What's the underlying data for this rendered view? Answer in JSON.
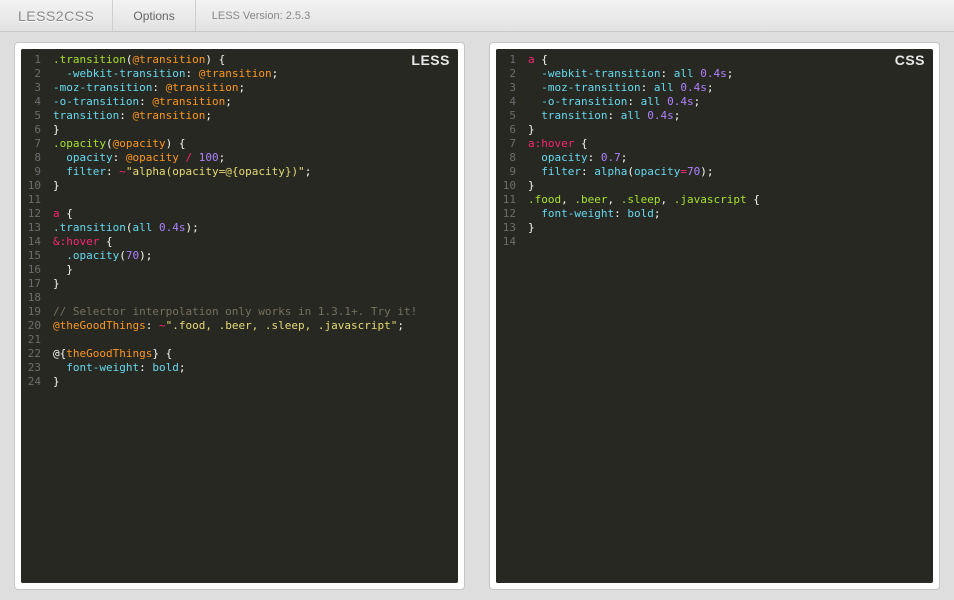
{
  "header": {
    "brand": "LESS2CSS",
    "options_label": "Options",
    "version_label": "LESS Version: 2.5.3"
  },
  "panels": {
    "left": {
      "label": "LESS"
    },
    "right": {
      "label": "CSS"
    }
  },
  "less_raw": ".transition(@transition) {\n  -webkit-transition: @transition;\n-moz-transition: @transition;\n-o-transition: @transition;\ntransition: @transition;\n}\n.opacity(@opacity) {\n  opacity: @opacity / 100;\n  filter: ~\"alpha(opacity=@{opacity})\";\n}\n\na {\n.transition(all 0.4s);\n&:hover {\n  .opacity(70);\n  }\n}\n\n// Selector interpolation only works in 1.3.1+. Try it!\n@theGoodThings: ~\".food, .beer, .sleep, .javascript\";\n\n@{theGoodThings} {\n  font-weight: bold;\n}",
  "css_raw": "a {\n  -webkit-transition: all 0.4s;\n  -moz-transition: all 0.4s;\n  -o-transition: all 0.4s;\n  transition: all 0.4s;\n}\na:hover {\n  opacity: 0.7;\n  filter: alpha(opacity=70);\n}\n.food, .beer, .sleep, .javascript {\n  font-weight: bold;\n}\n",
  "less_lines": [
    [
      {
        "t": ".transition",
        "c": "c-sel"
      },
      {
        "t": "(",
        "c": "c-punc"
      },
      {
        "t": "@transition",
        "c": "c-var"
      },
      {
        "t": ") {",
        "c": "c-punc"
      }
    ],
    [
      {
        "t": "  ",
        "c": "c-plain"
      },
      {
        "t": "-webkit-transition",
        "c": "c-prop"
      },
      {
        "t": ": ",
        "c": "c-punc"
      },
      {
        "t": "@transition",
        "c": "c-var"
      },
      {
        "t": ";",
        "c": "c-punc"
      }
    ],
    [
      {
        "t": "-moz-transition",
        "c": "c-prop"
      },
      {
        "t": ": ",
        "c": "c-punc"
      },
      {
        "t": "@transition",
        "c": "c-var"
      },
      {
        "t": ";",
        "c": "c-punc"
      }
    ],
    [
      {
        "t": "-o-transition",
        "c": "c-prop"
      },
      {
        "t": ": ",
        "c": "c-punc"
      },
      {
        "t": "@transition",
        "c": "c-var"
      },
      {
        "t": ";",
        "c": "c-punc"
      }
    ],
    [
      {
        "t": "transition",
        "c": "c-prop"
      },
      {
        "t": ": ",
        "c": "c-punc"
      },
      {
        "t": "@transition",
        "c": "c-var"
      },
      {
        "t": ";",
        "c": "c-punc"
      }
    ],
    [
      {
        "t": "}",
        "c": "c-punc"
      }
    ],
    [
      {
        "t": ".opacity",
        "c": "c-sel"
      },
      {
        "t": "(",
        "c": "c-punc"
      },
      {
        "t": "@opacity",
        "c": "c-var"
      },
      {
        "t": ") {",
        "c": "c-punc"
      }
    ],
    [
      {
        "t": "  ",
        "c": "c-plain"
      },
      {
        "t": "opacity",
        "c": "c-prop"
      },
      {
        "t": ": ",
        "c": "c-punc"
      },
      {
        "t": "@opacity",
        "c": "c-var"
      },
      {
        "t": " / ",
        "c": "c-op"
      },
      {
        "t": "100",
        "c": "c-num"
      },
      {
        "t": ";",
        "c": "c-punc"
      }
    ],
    [
      {
        "t": "  ",
        "c": "c-plain"
      },
      {
        "t": "filter",
        "c": "c-prop"
      },
      {
        "t": ": ",
        "c": "c-punc"
      },
      {
        "t": "~",
        "c": "c-op"
      },
      {
        "t": "\"alpha(opacity=@{opacity})\"",
        "c": "c-str"
      },
      {
        "t": ";",
        "c": "c-punc"
      }
    ],
    [
      {
        "t": "}",
        "c": "c-punc"
      }
    ],
    [
      {
        "t": " ",
        "c": "c-plain"
      }
    ],
    [
      {
        "t": "a",
        "c": "c-tag"
      },
      {
        "t": " {",
        "c": "c-punc"
      }
    ],
    [
      {
        "t": ".transition",
        "c": "c-mix"
      },
      {
        "t": "(",
        "c": "c-punc"
      },
      {
        "t": "all ",
        "c": "c-val"
      },
      {
        "t": "0.4s",
        "c": "c-num"
      },
      {
        "t": ");",
        "c": "c-punc"
      }
    ],
    [
      {
        "t": "&",
        "c": "c-op"
      },
      {
        "t": ":hover",
        "c": "c-key"
      },
      {
        "t": " {",
        "c": "c-punc"
      }
    ],
    [
      {
        "t": "  ",
        "c": "c-plain"
      },
      {
        "t": ".opacity",
        "c": "c-mix"
      },
      {
        "t": "(",
        "c": "c-punc"
      },
      {
        "t": "70",
        "c": "c-num"
      },
      {
        "t": ");",
        "c": "c-punc"
      }
    ],
    [
      {
        "t": "  }",
        "c": "c-punc"
      }
    ],
    [
      {
        "t": "}",
        "c": "c-punc"
      }
    ],
    [
      {
        "t": " ",
        "c": "c-plain"
      }
    ],
    [
      {
        "t": "// Selector interpolation only works in 1.3.1+. Try it!",
        "c": "c-comm"
      }
    ],
    [
      {
        "t": "@theGoodThings",
        "c": "c-var"
      },
      {
        "t": ": ",
        "c": "c-punc"
      },
      {
        "t": "~",
        "c": "c-op"
      },
      {
        "t": "\".food, .beer, .sleep, .javascript\"",
        "c": "c-str"
      },
      {
        "t": ";",
        "c": "c-punc"
      }
    ],
    [
      {
        "t": " ",
        "c": "c-plain"
      }
    ],
    [
      {
        "t": "@{",
        "c": "c-punc"
      },
      {
        "t": "theGoodThings",
        "c": "c-var"
      },
      {
        "t": "} {",
        "c": "c-punc"
      }
    ],
    [
      {
        "t": "  ",
        "c": "c-plain"
      },
      {
        "t": "font-weight",
        "c": "c-prop"
      },
      {
        "t": ": ",
        "c": "c-punc"
      },
      {
        "t": "bold",
        "c": "c-val"
      },
      {
        "t": ";",
        "c": "c-punc"
      }
    ],
    [
      {
        "t": "}",
        "c": "c-punc"
      }
    ]
  ],
  "css_lines": [
    [
      {
        "t": "a",
        "c": "c-tag"
      },
      {
        "t": " {",
        "c": "c-punc"
      }
    ],
    [
      {
        "t": "  ",
        "c": "c-plain"
      },
      {
        "t": "-webkit-transition",
        "c": "c-prop"
      },
      {
        "t": ": ",
        "c": "c-punc"
      },
      {
        "t": "all ",
        "c": "c-val"
      },
      {
        "t": "0.4s",
        "c": "c-num"
      },
      {
        "t": ";",
        "c": "c-punc"
      }
    ],
    [
      {
        "t": "  ",
        "c": "c-plain"
      },
      {
        "t": "-moz-transition",
        "c": "c-prop"
      },
      {
        "t": ": ",
        "c": "c-punc"
      },
      {
        "t": "all ",
        "c": "c-val"
      },
      {
        "t": "0.4s",
        "c": "c-num"
      },
      {
        "t": ";",
        "c": "c-punc"
      }
    ],
    [
      {
        "t": "  ",
        "c": "c-plain"
      },
      {
        "t": "-o-transition",
        "c": "c-prop"
      },
      {
        "t": ": ",
        "c": "c-punc"
      },
      {
        "t": "all ",
        "c": "c-val"
      },
      {
        "t": "0.4s",
        "c": "c-num"
      },
      {
        "t": ";",
        "c": "c-punc"
      }
    ],
    [
      {
        "t": "  ",
        "c": "c-plain"
      },
      {
        "t": "transition",
        "c": "c-prop"
      },
      {
        "t": ": ",
        "c": "c-punc"
      },
      {
        "t": "all ",
        "c": "c-val"
      },
      {
        "t": "0.4s",
        "c": "c-num"
      },
      {
        "t": ";",
        "c": "c-punc"
      }
    ],
    [
      {
        "t": "}",
        "c": "c-punc"
      }
    ],
    [
      {
        "t": "a",
        "c": "c-tag"
      },
      {
        "t": ":hover",
        "c": "c-key"
      },
      {
        "t": " {",
        "c": "c-punc"
      }
    ],
    [
      {
        "t": "  ",
        "c": "c-plain"
      },
      {
        "t": "opacity",
        "c": "c-prop"
      },
      {
        "t": ": ",
        "c": "c-punc"
      },
      {
        "t": "0.7",
        "c": "c-num"
      },
      {
        "t": ";",
        "c": "c-punc"
      }
    ],
    [
      {
        "t": "  ",
        "c": "c-plain"
      },
      {
        "t": "filter",
        "c": "c-prop"
      },
      {
        "t": ": ",
        "c": "c-punc"
      },
      {
        "t": "alpha",
        "c": "c-val"
      },
      {
        "t": "(",
        "c": "c-punc"
      },
      {
        "t": "opacity",
        "c": "c-prop"
      },
      {
        "t": "=",
        "c": "c-op"
      },
      {
        "t": "70",
        "c": "c-num"
      },
      {
        "t": ");",
        "c": "c-punc"
      }
    ],
    [
      {
        "t": "}",
        "c": "c-punc"
      }
    ],
    [
      {
        "t": ".food",
        "c": "c-sel"
      },
      {
        "t": ", ",
        "c": "c-punc"
      },
      {
        "t": ".beer",
        "c": "c-sel"
      },
      {
        "t": ", ",
        "c": "c-punc"
      },
      {
        "t": ".sleep",
        "c": "c-sel"
      },
      {
        "t": ", ",
        "c": "c-punc"
      },
      {
        "t": ".javascript",
        "c": "c-sel"
      },
      {
        "t": " {",
        "c": "c-punc"
      }
    ],
    [
      {
        "t": "  ",
        "c": "c-plain"
      },
      {
        "t": "font-weight",
        "c": "c-prop"
      },
      {
        "t": ": ",
        "c": "c-punc"
      },
      {
        "t": "bold",
        "c": "c-val"
      },
      {
        "t": ";",
        "c": "c-punc"
      }
    ],
    [
      {
        "t": "}",
        "c": "c-punc"
      }
    ],
    [
      {
        "t": " ",
        "c": "c-plain"
      }
    ]
  ]
}
